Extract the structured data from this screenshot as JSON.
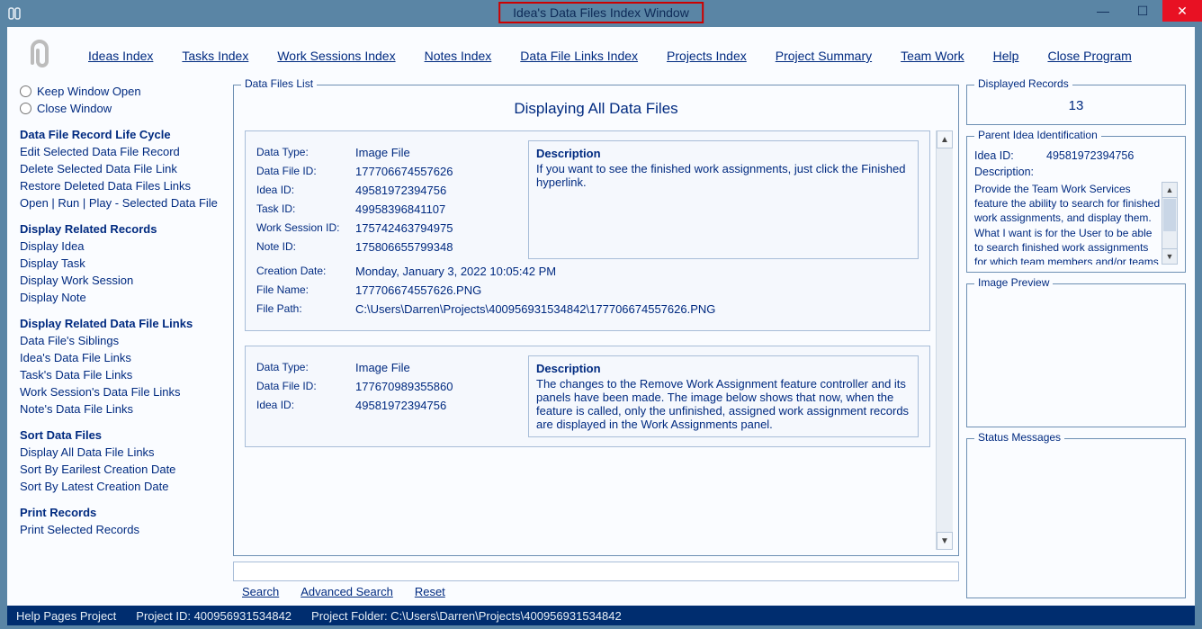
{
  "window": {
    "title": "Idea's Data Files Index Window"
  },
  "nav": {
    "ideas_index": "Ideas Index",
    "tasks_index": "Tasks Index",
    "work_sessions_index": "Work Sessions Index",
    "notes_index": "Notes Index",
    "data_file_links_index": "Data File Links Index",
    "projects_index": "Projects Index",
    "project_summary": "Project Summary",
    "team_work": "Team Work",
    "help": "Help",
    "close_program": "Close Program"
  },
  "left": {
    "keep_window_open": "Keep Window Open",
    "close_window": "Close Window",
    "groups": {
      "lifecycle": {
        "heading": "Data File Record Life Cycle",
        "edit": "Edit Selected Data File Record",
        "delete": "Delete Selected Data File Link",
        "restore": "Restore Deleted Data Files Links",
        "open_run": "Open | Run | Play - Selected Data File"
      },
      "related_records": {
        "heading": "Display Related Records",
        "idea": "Display Idea",
        "task": "Display Task",
        "work_session": "Display Work Session",
        "note": "Display Note"
      },
      "related_links": {
        "heading": "Display Related Data File Links",
        "siblings": "Data File's Siblings",
        "idea_links": "Idea's Data File Links",
        "task_links": "Task's Data File Links",
        "ws_links": "Work Session's Data File Links",
        "note_links": "Note's Data File Links"
      },
      "sort": {
        "heading": "Sort Data Files",
        "display_all": "Display All Data File Links",
        "earliest": "Sort By Earilest Creation Date",
        "latest": "Sort By Latest Creation Date"
      },
      "print": {
        "heading": "Print Records",
        "print_selected": "Print Selected Records"
      }
    }
  },
  "center": {
    "legend": "Data Files List",
    "heading": "Displaying All Data Files",
    "labels": {
      "data_type": "Data Type:",
      "data_file_id": "Data File ID:",
      "idea_id": "Idea ID:",
      "task_id": "Task ID:",
      "ws_id": "Work Session ID:",
      "note_id": "Note ID:",
      "creation_date": "Creation Date:",
      "file_name": "File Name:",
      "file_path": "File Path:",
      "description": "Description"
    },
    "records": [
      {
        "data_type": "Image File",
        "data_file_id": "177706674557626",
        "idea_id": "49581972394756",
        "task_id": "49958396841107",
        "ws_id": "175742463794975",
        "note_id": "175806655799348",
        "creation_date": "Monday, January 3, 2022   10:05:42 PM",
        "file_name": "177706674557626.PNG",
        "file_path": "C:\\Users\\Darren\\Projects\\400956931534842\\177706674557626.PNG",
        "description": "If you want to see the finished work assignments, just click the Finished hyperlink."
      },
      {
        "data_type": "Image File",
        "data_file_id": "177670989355860",
        "idea_id": "49581972394756",
        "description": "The changes to the Remove Work Assignment feature controller and its panels have been made. The image below shows that now, when the feature is called, only the unfinished, assigned work assignment records are displayed in the Work Assignments panel."
      }
    ],
    "search_links": {
      "search": "Search",
      "advanced": "Advanced Search",
      "reset": "Reset"
    }
  },
  "right": {
    "displayed_records_legend": "Displayed Records",
    "displayed_records_value": "13",
    "parent_legend": "Parent Idea Identification",
    "parent": {
      "idea_id_label": "Idea ID:",
      "idea_id_value": "49581972394756",
      "desc_label": "Description:",
      "desc_value": "Provide the Team Work Services feature the ability to search for finished work assignments, and display them. What I want is for the User to be able to search finished work assignments for which team members and/or teams worked on them"
    },
    "image_preview_legend": "Image Preview",
    "status_legend": "Status Messages"
  },
  "status_bar": {
    "help_pages": "Help Pages Project",
    "project_id": "Project ID: 400956931534842",
    "project_folder": "Project Folder: C:\\Users\\Darren\\Projects\\400956931534842"
  }
}
